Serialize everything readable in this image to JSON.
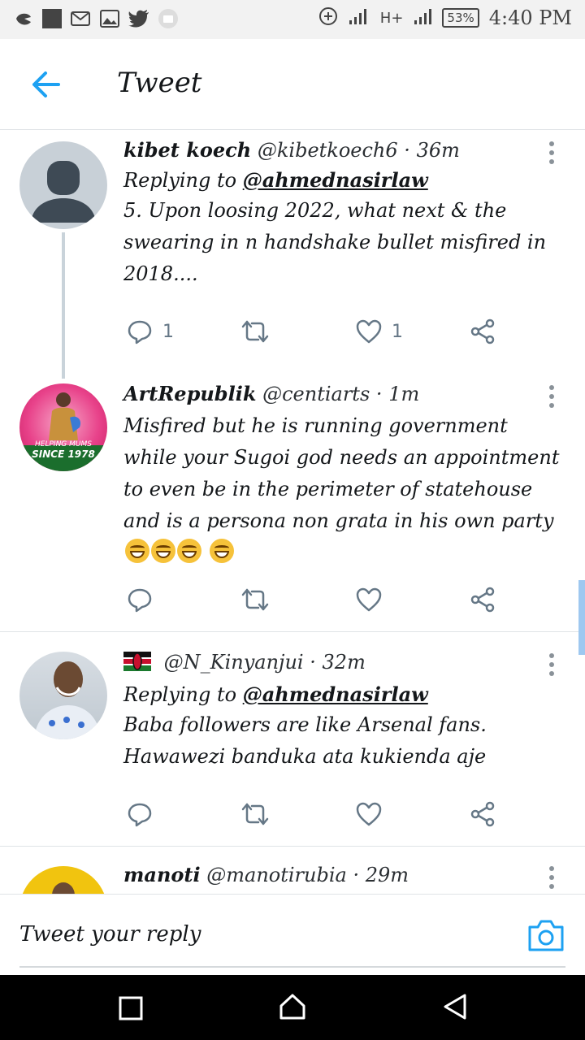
{
  "status_bar": {
    "battery": "53%",
    "time": "4:40 PM",
    "network": "H+"
  },
  "header": {
    "title": "Tweet"
  },
  "tweets": [
    {
      "name": "kibet koech",
      "handle": "@kibetkoech6",
      "time": "36m",
      "replying_label": "Replying to",
      "replying_to": "@ahmednasirlaw",
      "text": "5. Upon loosing 2022, what next & the swearing in n handshake bullet misfired in 2018....",
      "reply_count": "1",
      "like_count": "1"
    },
    {
      "name": "ArtRepublik",
      "handle": "@centiarts",
      "time": "1m",
      "text": "Misfired but he is running government while your Sugoi god needs an appointment to even be in the perimeter of statehouse and is a persona non grata in his own party",
      "avatar_text_1": "HELPING MUMS",
      "avatar_text_2": "SINCE 1978"
    },
    {
      "name": "",
      "handle": "@N_Kinyanjui",
      "time": "32m",
      "replying_label": "Replying to",
      "replying_to": "@ahmednasirlaw",
      "text_line1": "Baba followers are like Arsenal fans.",
      "text_line2": "Hawawezi banduka ata kukienda aje"
    },
    {
      "name": "manoti",
      "handle": "@manotirubia",
      "time": "29m"
    }
  ],
  "reply_bar": {
    "placeholder": "Tweet your reply"
  },
  "colors": {
    "accent": "#1da1f2",
    "icon_grey": "#657786",
    "divider": "#dfe3e6"
  }
}
